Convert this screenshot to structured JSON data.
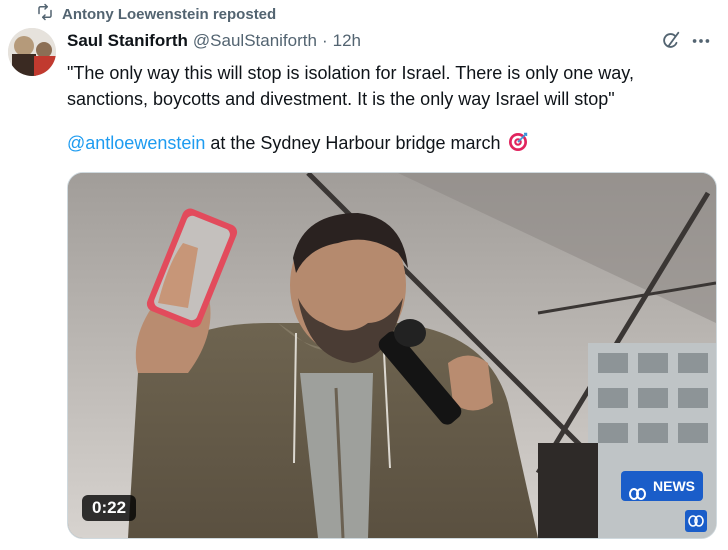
{
  "repost": {
    "icon": "repost-icon",
    "text": "Antony Loewenstein reposted"
  },
  "author": {
    "avatar": "avatar",
    "name": "Saul Staniforth",
    "handle": "@SaulStaniforth",
    "separator": "·",
    "time": "12h"
  },
  "tweet": {
    "text": "\"The only way this will stop is isolation for Israel. There is only one way, sanctions, boycotts and divestment. It is the only way Israel will stop\"",
    "mention": "@antloewenstein",
    "after_mention": " at the Sydney Harbour bridge march",
    "emoji": "target-emoji"
  },
  "media": {
    "duration": "0:22",
    "broadcaster_badge": "NEWS",
    "broadcaster_logo": "abc-logo"
  },
  "colors": {
    "link": "#1d9bf0",
    "secondary_text": "#536471",
    "abc_blue": "#1a5dc9"
  }
}
